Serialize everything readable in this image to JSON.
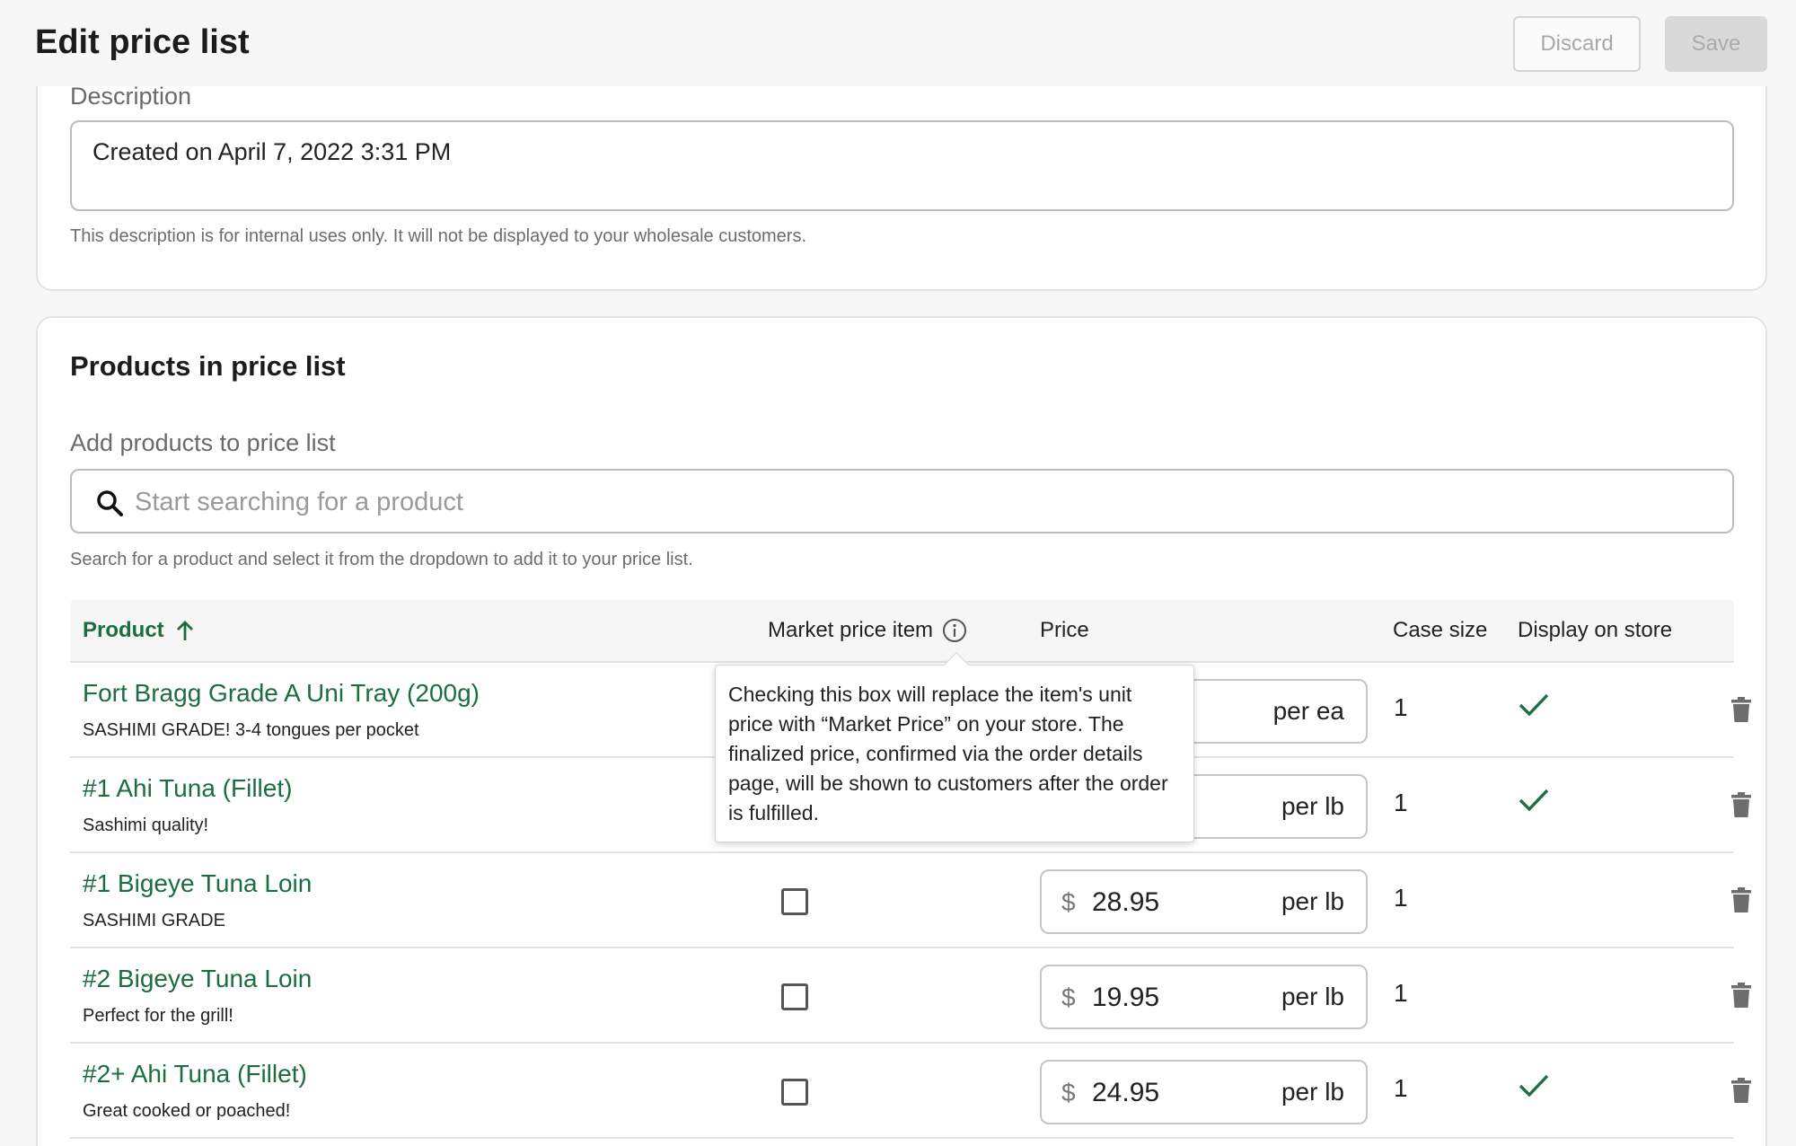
{
  "header": {
    "title": "Edit price list",
    "discard_label": "Discard",
    "save_label": "Save"
  },
  "description_section": {
    "label": "Description",
    "value": "Created on April 7, 2022 3:31 PM",
    "helper": "This description is for internal uses only. It will not be displayed to your wholesale customers."
  },
  "products_section": {
    "title": "Products in price list",
    "add_label": "Add products to price list",
    "search_placeholder": "Start searching for a product",
    "search_helper": "Search for a product and select it from the dropdown to add it to your price list."
  },
  "table": {
    "headers": {
      "product": "Product",
      "market_price": "Market price item",
      "price": "Price",
      "case_size": "Case size",
      "display_on_store": "Display on store"
    },
    "rows": [
      {
        "name": "Fort Bragg Grade A Uni Tray (200g)",
        "subtitle": "SASHIMI GRADE! 3-4 tongues per pocket",
        "market_price": false,
        "currency": "$",
        "price": "",
        "unit": "per ea",
        "case_size": "1",
        "display": true
      },
      {
        "name": "#1 Ahi Tuna (Fillet)",
        "subtitle": "Sashimi quality!",
        "market_price": false,
        "currency": "$",
        "price": "",
        "unit": "per lb",
        "case_size": "1",
        "display": true
      },
      {
        "name": "#1 Bigeye Tuna Loin",
        "subtitle": "SASHIMI GRADE",
        "market_price": false,
        "currency": "$",
        "price": "28.95",
        "unit": "per lb",
        "case_size": "1",
        "display": false
      },
      {
        "name": "#2 Bigeye Tuna Loin",
        "subtitle": "Perfect for the grill!",
        "market_price": false,
        "currency": "$",
        "price": "19.95",
        "unit": "per lb",
        "case_size": "1",
        "display": false
      },
      {
        "name": "#2+ Ahi Tuna (Fillet)",
        "subtitle": "Great cooked or poached!",
        "market_price": false,
        "currency": "$",
        "price": "24.95",
        "unit": "per lb",
        "case_size": "1",
        "display": true
      }
    ]
  },
  "tooltip": {
    "text": "Checking this box will replace the item's unit price with “Market Price” on your store. The finalized price, confirmed via the order details page, will be shown to customers after the order is fulfilled."
  },
  "colors": {
    "accent_green": "#1b6e3f",
    "check_green": "#1e6e43"
  },
  "icons": [
    "search-icon",
    "sort-up-arrow-icon",
    "info-icon",
    "checkmark-icon",
    "trash-icon"
  ]
}
